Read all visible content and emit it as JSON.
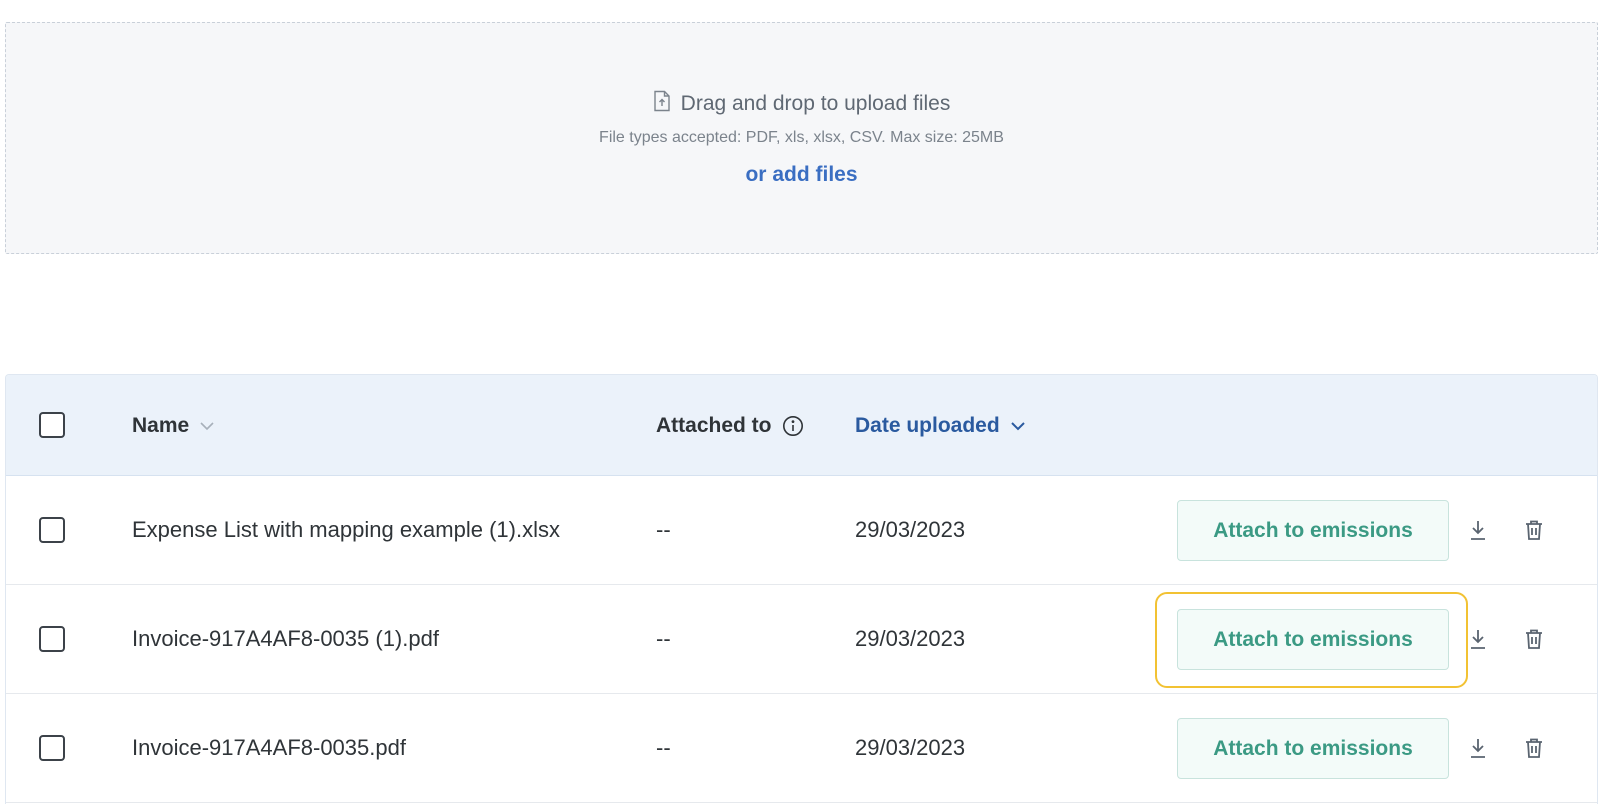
{
  "upload": {
    "title": "Drag and drop to upload files",
    "subtitle": "File types accepted: PDF, xls, xlsx, CSV. Max size: 25MB",
    "add_link": "or add files"
  },
  "table": {
    "columns": {
      "name": "Name",
      "attached_to": "Attached to",
      "date_uploaded": "Date uploaded"
    },
    "sort": {
      "active_column": "date_uploaded",
      "direction": "descending"
    },
    "rows": [
      {
        "name": "Expense List with mapping example (1).xlsx",
        "attached_to": "--",
        "date": "29/03/2023",
        "action": "Attach to emissions",
        "checked": false
      },
      {
        "name": "Invoice-917A4AF8-0035 (1).pdf",
        "attached_to": "--",
        "date": "29/03/2023",
        "action": "Attach to emissions",
        "checked": false,
        "focused": true
      },
      {
        "name": "Invoice-917A4AF8-0035.pdf",
        "attached_to": "--",
        "date": "29/03/2023",
        "action": "Attach to emissions",
        "checked": false
      }
    ]
  },
  "colors": {
    "accent_link": "#3a6ec2",
    "header_active": "#2a5a9f",
    "action_text": "#3b9a84",
    "focus_ring": "#f2c233"
  },
  "icons": {
    "upload": "file-upload-icon",
    "sort": "chevron-down-icon",
    "info": "info-icon",
    "download": "download-icon",
    "delete": "trash-icon"
  }
}
